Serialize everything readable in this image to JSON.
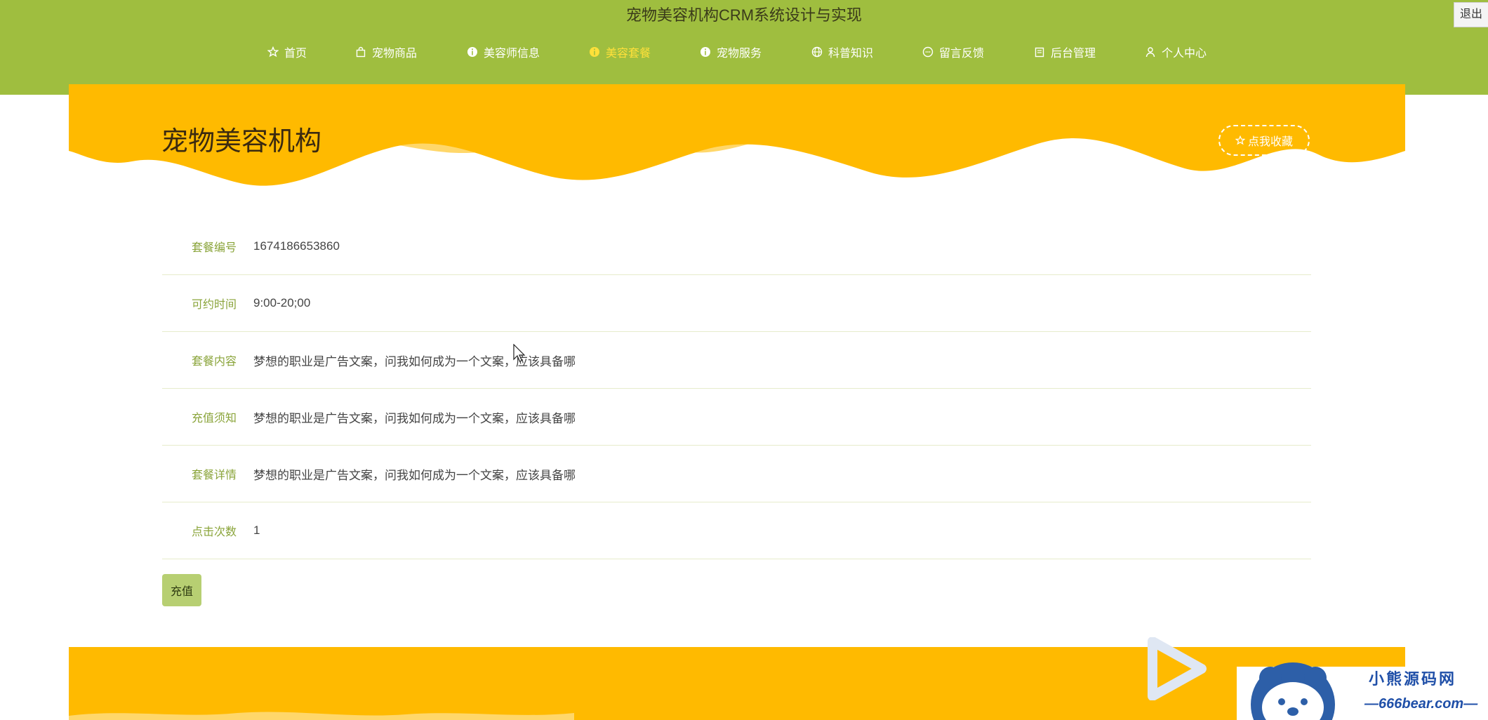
{
  "site": {
    "title": "宠物美容机构CRM系统设计与实现",
    "logout_label": "退出"
  },
  "nav": {
    "items": [
      {
        "label": "首页",
        "icon": "star-icon",
        "active": false
      },
      {
        "label": "宠物商品",
        "icon": "bag-icon",
        "active": false
      },
      {
        "label": "美容师信息",
        "icon": "info-icon",
        "active": false
      },
      {
        "label": "美容套餐",
        "icon": "info-icon",
        "active": true
      },
      {
        "label": "宠物服务",
        "icon": "info-icon",
        "active": false
      },
      {
        "label": "科普知识",
        "icon": "globe-icon",
        "active": false
      },
      {
        "label": "留言反馈",
        "icon": "chat-icon",
        "active": false
      },
      {
        "label": "后台管理",
        "icon": "building-icon",
        "active": false
      },
      {
        "label": "个人中心",
        "icon": "user-icon",
        "active": false
      }
    ],
    "active_color": "#ffe03a"
  },
  "banner": {
    "title": "宠物美容机构",
    "favorite_label": "点我收藏"
  },
  "details": {
    "rows": [
      {
        "label": "套餐编号",
        "value": "1674186653860"
      },
      {
        "label": "可约时间",
        "value": "9:00-20;00"
      },
      {
        "label": "套餐内容",
        "value": "梦想的职业是广告文案，问我如何成为一个文案，应该具备哪"
      },
      {
        "label": "充值须知",
        "value": "梦想的职业是广告文案，问我如何成为一个文案，应该具备哪"
      },
      {
        "label": "套餐详情",
        "value": "梦想的职业是广告文案，问我如何成为一个文案，应该具备哪"
      },
      {
        "label": "点击次数",
        "value": "1"
      }
    ]
  },
  "actions": {
    "recharge_label": "充值"
  },
  "watermark": {
    "name": "小熊源码网",
    "url": "—666bear.com—"
  },
  "colors": {
    "header_green": "#9fbe3f",
    "banner_yellow": "#ffba00",
    "label_green": "#8aa43a",
    "button_green": "#b7cf72"
  }
}
